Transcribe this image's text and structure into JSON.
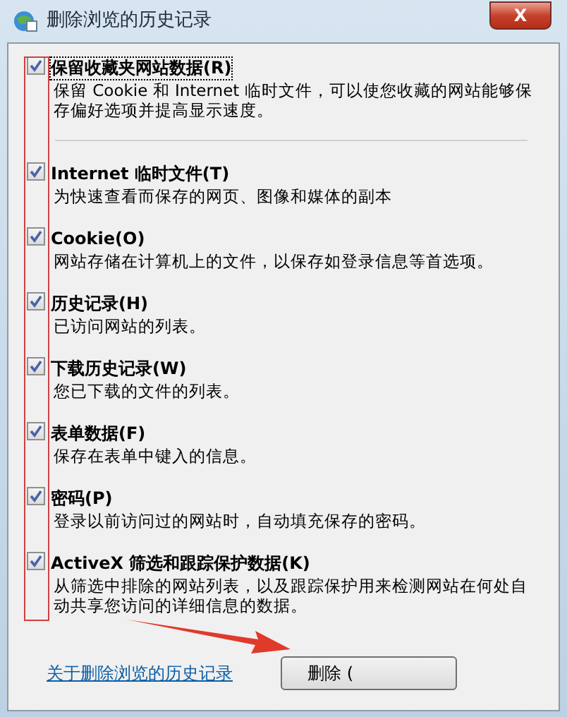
{
  "window": {
    "title": "删除浏览的历史记录",
    "close_label": "X"
  },
  "options": [
    {
      "label": "保留收藏夹网站数据(R)",
      "description": "保留 Cookie 和 Internet 临时文件，可以使您收藏的网站能够保存偏好选项并提高显示速度。",
      "checked": true,
      "focused": true
    },
    {
      "label": "Internet 临时文件(T)",
      "description": "为快速查看而保存的网页、图像和媒体的副本",
      "checked": true,
      "focused": false
    },
    {
      "label": "Cookie(O)",
      "description": "网站存储在计算机上的文件，以保存如登录信息等首选项。",
      "checked": true,
      "focused": false
    },
    {
      "label": "历史记录(H)",
      "description": "已访问网站的列表。",
      "checked": true,
      "focused": false
    },
    {
      "label": "下载历史记录(W)",
      "description": "您已下载的文件的列表。",
      "checked": true,
      "focused": false
    },
    {
      "label": "表单数据(F)",
      "description": "保存在表单中键入的信息。",
      "checked": true,
      "focused": false
    },
    {
      "label": "密码(P)",
      "description": "登录以前访问过的网站时，自动填充保存的密码。",
      "checked": true,
      "focused": false
    },
    {
      "label": "ActiveX 筛选和跟踪保护数据(K)",
      "description": "从筛选中排除的网站列表，以及跟踪保护用来检测网站在何处自动共享您访问的详细信息的数据。",
      "checked": true,
      "focused": false
    }
  ],
  "footer": {
    "link": "关于删除浏览的历史记录",
    "button": "删除 ("
  },
  "annotations": {
    "highlight_frame": true,
    "arrow": true
  }
}
